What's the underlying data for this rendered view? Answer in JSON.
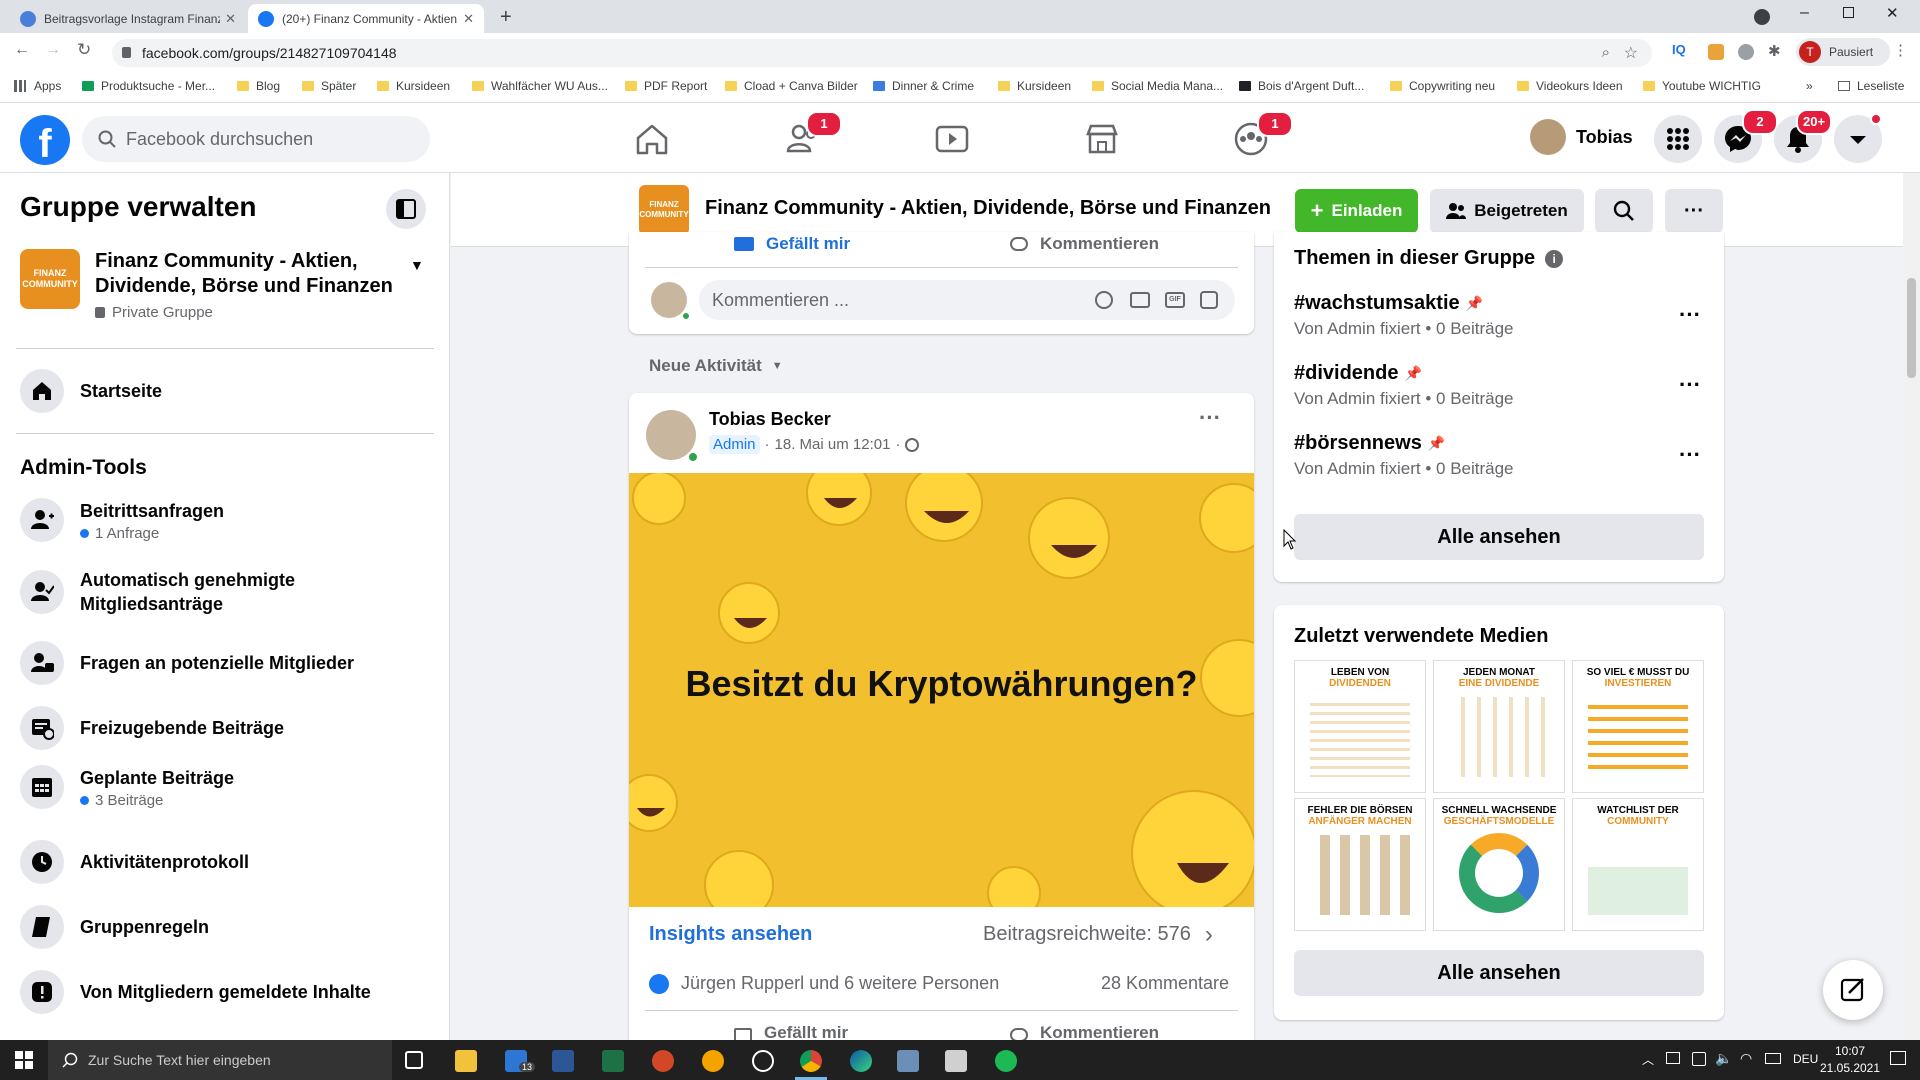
{
  "browser": {
    "tabs": [
      {
        "title": "Beitragsvorlage Instagram Finanz"
      },
      {
        "title": "(20+) Finanz Community - Aktien"
      }
    ],
    "url": "facebook.com/groups/214827109704148",
    "profile_label": "Pausiert",
    "profile_initial": "T",
    "bookmarks": [
      "Apps",
      "Produktsuche - Mer...",
      "Blog",
      "Später",
      "Kursideen",
      "Wahlfächer WU Aus...",
      "PDF Report",
      "Cload + Canva Bilder",
      "Dinner & Crime",
      "Kursideen",
      "Social Media Mana...",
      "Bois d'Argent Duft...",
      "Copywriting neu",
      "Videokurs Ideen",
      "Youtube WICHTIG"
    ],
    "reading_list": "Leseliste",
    "more": "»"
  },
  "header": {
    "logo": "f",
    "search_placeholder": "Facebook durchsuchen",
    "friends_badge": "1",
    "groups_badge": "1",
    "user_name": "Tobias",
    "messenger_badge": "2",
    "notifications_badge": "20+"
  },
  "sidebar": {
    "title": "Gruppe verwalten",
    "group_name": "Finanz Community - Aktien, Dividende, Börse und Finanzen",
    "group_privacy": "Private Gruppe",
    "group_logo_text": "FINANZ COMMUNITY",
    "home": "Startseite",
    "admin_tools_heading": "Admin-Tools",
    "items": [
      {
        "label": "Beitrittsanfragen",
        "sub": "1 Anfrage"
      },
      {
        "label": "Automatisch genehmigte Mitgliedsanträge",
        "sub": ""
      },
      {
        "label": "Fragen an potenzielle Mitglieder",
        "sub": ""
      },
      {
        "label": "Freizugebende Beiträge",
        "sub": ""
      },
      {
        "label": "Geplante Beiträge",
        "sub": "3 Beiträge"
      },
      {
        "label": "Aktivitätenprotokoll",
        "sub": ""
      },
      {
        "label": "Gruppenregeln",
        "sub": ""
      },
      {
        "label": "Von Mitgliedern gemeldete Inhalte",
        "sub": ""
      }
    ]
  },
  "group_bar": {
    "title": "Finanz Community - Aktien, Dividende, Börse und Finanzen",
    "invite": "Einladen",
    "joined": "Beigetreten",
    "more": "···"
  },
  "feed": {
    "prev_actions": {
      "like": "Gefällt mir",
      "comment": "Kommentieren"
    },
    "comment_placeholder": "Kommentieren ...",
    "sort_label": "Neue Aktivität",
    "post": {
      "author": "Tobias Becker",
      "role": "Admin",
      "time": "18. Mai um 12:01",
      "image_text": "Besitzt du Kryptowährungen?",
      "insights": "Insights ansehen",
      "reach": "Beitragsreichweite: 576",
      "reactions": "Jürgen Rupperl und 6 weitere Personen",
      "comments": "28 Kommentare",
      "like": "Gefällt mir",
      "comment": "Kommentieren"
    }
  },
  "right": {
    "topics_title": "Themen in dieser Gruppe",
    "topics": [
      {
        "tag": "#wachstumsaktie",
        "meta": "Von Admin fixiert • 0 Beiträge"
      },
      {
        "tag": "#dividende",
        "meta": "Von Admin fixiert • 0 Beiträge"
      },
      {
        "tag": "#börsennews",
        "meta": "Von Admin fixiert • 0 Beiträge"
      }
    ],
    "see_all": "Alle ansehen",
    "media_title": "Zuletzt verwendete Medien",
    "media": [
      {
        "top": "LEBEN VON",
        "accent": "DIVIDENDEN"
      },
      {
        "top": "JEDEN MONAT",
        "accent": "EINE DIVIDENDE"
      },
      {
        "top": "SO VIEL € MUSST DU",
        "accent": "INVESTIEREN"
      },
      {
        "top": "FEHLER DIE BÖRSEN",
        "accent": "ANFÄNGER MACHEN"
      },
      {
        "top": "SCHNELL WACHSENDE",
        "accent": "GESCHÄFTSMODELLE"
      },
      {
        "top": "WATCHLIST DER",
        "accent": "COMMUNITY"
      }
    ],
    "media_see_all": "Alle ansehen"
  },
  "taskbar": {
    "search_placeholder": "Zur Suche Text hier eingeben",
    "mail_badge": "13",
    "lang": "DEU",
    "time": "10:07",
    "date": "21.05.2021"
  },
  "colors": {
    "fb_blue": "#1877f2",
    "green": "#42b72a",
    "post_bg": "#f2bf2e",
    "badge_red": "#e41e3f"
  }
}
